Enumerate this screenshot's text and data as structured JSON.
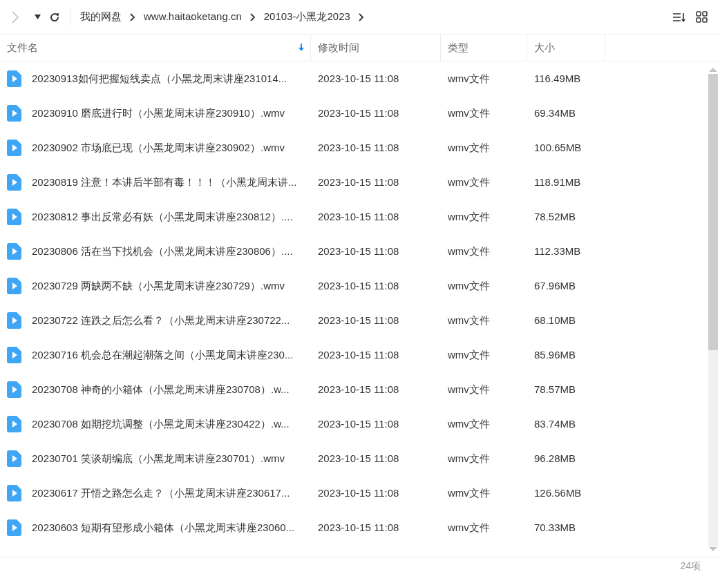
{
  "breadcrumb": [
    "我的网盘",
    "www.haitaoketang.cn",
    "20103-小黑龙2023"
  ],
  "columns": [
    {
      "label": "文件名",
      "sorted": true
    },
    {
      "label": "修改时间",
      "sorted": false
    },
    {
      "label": "类型",
      "sorted": false
    },
    {
      "label": "大小",
      "sorted": false
    }
  ],
  "rows": [
    {
      "name": "20230913如何把握短线卖点（小黑龙周末讲座231014...",
      "modified": "2023-10-15 11:08",
      "type": "wmv文件",
      "size": "116.49MB"
    },
    {
      "name": "20230910 磨底进行时（小黑龙周末讲座230910）.wmv",
      "modified": "2023-10-15 11:08",
      "type": "wmv文件",
      "size": "69.34MB"
    },
    {
      "name": "20230902 市场底已现（小黑龙周末讲座230902）.wmv",
      "modified": "2023-10-15 11:08",
      "type": "wmv文件",
      "size": "100.65MB"
    },
    {
      "name": "20230819 注意！本讲后半部有毒！！！（小黑龙周末讲...",
      "modified": "2023-10-15 11:08",
      "type": "wmv文件",
      "size": "118.91MB"
    },
    {
      "name": "20230812 事出反常必有妖（小黑龙周末讲座230812）....",
      "modified": "2023-10-15 11:08",
      "type": "wmv文件",
      "size": "78.52MB"
    },
    {
      "name": "20230806 活在当下找机会（小黑龙周末讲座230806）....",
      "modified": "2023-10-15 11:08",
      "type": "wmv文件",
      "size": "112.33MB"
    },
    {
      "name": "20230729 两缺两不缺（小黑龙周末讲座230729）.wmv",
      "modified": "2023-10-15 11:08",
      "type": "wmv文件",
      "size": "67.96MB"
    },
    {
      "name": "20230722 连跌之后怎么看？（小黑龙周末讲座230722...",
      "modified": "2023-10-15 11:08",
      "type": "wmv文件",
      "size": "68.10MB"
    },
    {
      "name": "20230716 机会总在潮起潮落之间（小黑龙周末讲座230...",
      "modified": "2023-10-15 11:08",
      "type": "wmv文件",
      "size": "85.96MB"
    },
    {
      "name": "20230708 神奇的小箱体（小黑龙周末讲座230708）.w...",
      "modified": "2023-10-15 11:08",
      "type": "wmv文件",
      "size": "78.57MB"
    },
    {
      "name": "20230708 如期挖坑调整（小黑龙周末讲座230422）.w...",
      "modified": "2023-10-15 11:08",
      "type": "wmv文件",
      "size": "83.74MB"
    },
    {
      "name": "20230701 笑谈胡编底（小黑龙周末讲座230701）.wmv",
      "modified": "2023-10-15 11:08",
      "type": "wmv文件",
      "size": "96.28MB"
    },
    {
      "name": "20230617 开悟之路怎么走？（小黑龙周末讲座230617...",
      "modified": "2023-10-15 11:08",
      "type": "wmv文件",
      "size": "126.56MB"
    },
    {
      "name": "20230603 短期有望形成小箱体（小黑龙周末讲座23060...",
      "modified": "2023-10-15 11:08",
      "type": "wmv文件",
      "size": "70.33MB"
    }
  ],
  "status_bar": {
    "count": "24项"
  }
}
